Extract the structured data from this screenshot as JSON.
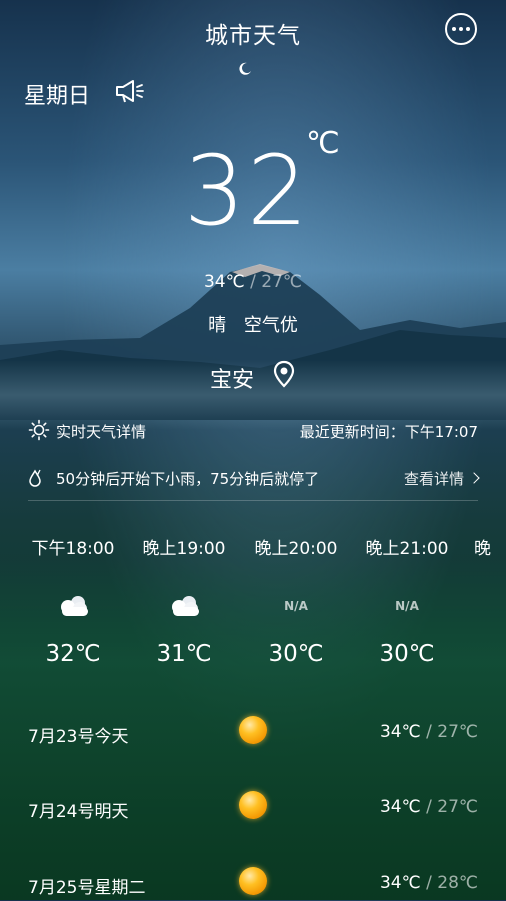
{
  "header": {
    "title": "城市天气"
  },
  "current": {
    "weekday": "星期日",
    "temperature": "32",
    "unit": "℃",
    "high": "34℃",
    "low": "27℃",
    "range_sep": " / ",
    "condition": "晴",
    "air_quality": "空气优",
    "location": "宝安"
  },
  "realtime": {
    "label": "实时天气详情",
    "updated": "最近更新时间：下午17:07"
  },
  "rain_alert": {
    "text": "50分钟后开始下小雨，75分钟后就停了",
    "detail_label": "查看详情"
  },
  "hourly": [
    {
      "time": "下午18:00",
      "icon": "cloud-icon",
      "icon_text": "",
      "temp": "32℃"
    },
    {
      "time": "晚上19:00",
      "icon": "cloud-icon",
      "icon_text": "",
      "temp": "31℃"
    },
    {
      "time": "晚上20:00",
      "icon": "na",
      "icon_text": "N/A",
      "temp": "30℃"
    },
    {
      "time": "晚上21:00",
      "icon": "na",
      "icon_text": "N/A",
      "temp": "30℃"
    },
    {
      "time": "晚",
      "icon": "",
      "icon_text": "",
      "temp": ""
    }
  ],
  "daily": [
    {
      "date": "7月23号今天",
      "icon": "sun-ball-icon",
      "high": "34℃",
      "low": "27℃"
    },
    {
      "date": "7月24号明天",
      "icon": "sun-ball-icon",
      "high": "34℃",
      "low": "27℃"
    },
    {
      "date": "7月25号星期二",
      "icon": "sun-ball-icon",
      "high": "34℃",
      "low": "28℃"
    }
  ],
  "colors": {
    "text": "#ffffff",
    "sun_ball": "#ffc023"
  }
}
